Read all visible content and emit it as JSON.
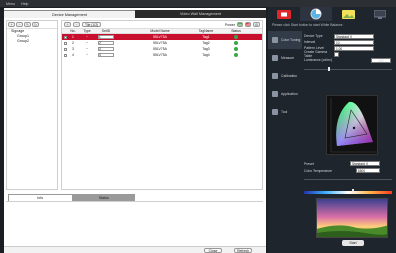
{
  "menubar": {
    "items": [
      "Menu",
      "Help"
    ]
  },
  "left": {
    "tabs": [
      "Device Management",
      "Video Wall Management"
    ],
    "tree": {
      "root": "Signage",
      "groups": [
        "Group1",
        "Group2"
      ]
    },
    "toolbar": {
      "select_value": "Tile (1/2)",
      "power_label": "Power",
      "power_on": "on",
      "power_off": "off"
    },
    "table": {
      "columns": [
        "",
        "No.",
        "Type",
        "SetID",
        "Model Name",
        "TagName",
        "Status"
      ],
      "rows": [
        {
          "no": "1",
          "type": "~",
          "setid": "1",
          "model": "55LV75A",
          "tag": "Tag1",
          "selected": true
        },
        {
          "no": "2",
          "type": "~",
          "setid": "2",
          "model": "55LV75A",
          "tag": "Tag2",
          "selected": false
        },
        {
          "no": "3",
          "type": "~",
          "setid": "3",
          "model": "55LV75A",
          "tag": "Tag3",
          "selected": false
        },
        {
          "no": "4",
          "type": "~",
          "setid": "4",
          "model": "55LV75A",
          "tag": "Tag4",
          "selected": false
        }
      ]
    },
    "bottom_tabs": [
      "Info",
      "Status"
    ],
    "footer": {
      "btn_close": "Close",
      "btn_refresh": "Refresh"
    }
  },
  "right": {
    "hint": "Please click Start button to start White Balance.",
    "side_items": [
      "Color Tuning",
      "Measure",
      "Calibration",
      "Application",
      "Tool"
    ],
    "props": [
      {
        "k": "Device Type",
        "v": "Standard II"
      },
      {
        "k": "Interval",
        "v": "10"
      },
      {
        "k": "Pattern Level",
        "v": "1.00"
      },
      {
        "k": "Create Gamma Table",
        "v": ""
      },
      {
        "k": "Luminance (cd/m²)",
        "v": "",
        "v2": "400"
      }
    ],
    "preset_label": "Preset",
    "preset_value": "Standard II",
    "temp_label": "Color Temperature",
    "temp_value": "6500",
    "ok_label": "Start"
  }
}
